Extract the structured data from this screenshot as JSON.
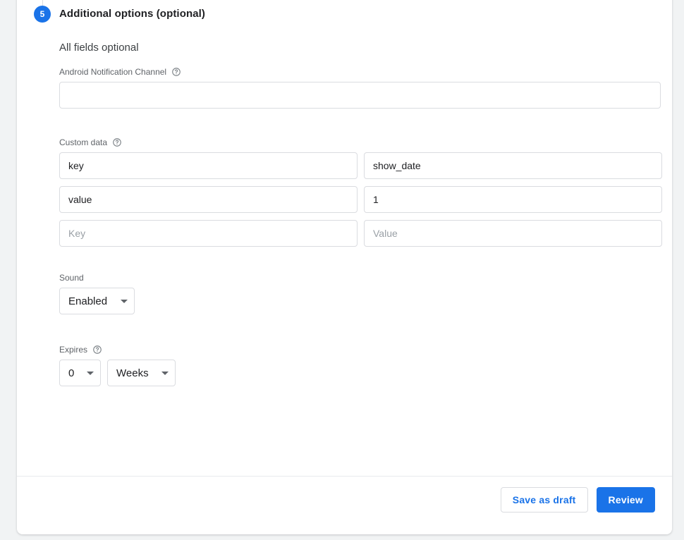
{
  "colors": {
    "accent": "#1a73e8",
    "card_bg": "#ffffff",
    "page_bg": "#f1f3f4",
    "border": "#dadce0",
    "label_text": "#5f6368",
    "primary_text": "#202124",
    "placeholder_text": "#9aa0a6"
  },
  "step": {
    "number": "5",
    "title": "Additional options (optional)"
  },
  "main": {
    "subheading": "All fields optional",
    "android_channel": {
      "label": "Android Notification Channel",
      "help_icon": "help-circle-icon",
      "value": "",
      "placeholder": ""
    },
    "custom_data": {
      "label": "Custom data",
      "help_icon": "help-circle-icon",
      "rows": [
        {
          "key_value": "key",
          "key_placeholder": "Key",
          "val_value": "show_date",
          "val_placeholder": "Value"
        },
        {
          "key_value": "value",
          "key_placeholder": "Key",
          "val_value": "1",
          "val_placeholder": "Value"
        },
        {
          "key_value": "",
          "key_placeholder": "Key",
          "val_value": "",
          "val_placeholder": "Value"
        }
      ]
    },
    "sound": {
      "label": "Sound",
      "selected": "Enabled",
      "caret_icon": "chevron-down-icon"
    },
    "expires": {
      "label": "Expires",
      "help_icon": "help-circle-icon",
      "amount_selected": "0",
      "unit_selected": "Weeks",
      "caret_icon": "chevron-down-icon"
    }
  },
  "footer": {
    "save_draft_label": "Save as draft",
    "review_label": "Review"
  }
}
